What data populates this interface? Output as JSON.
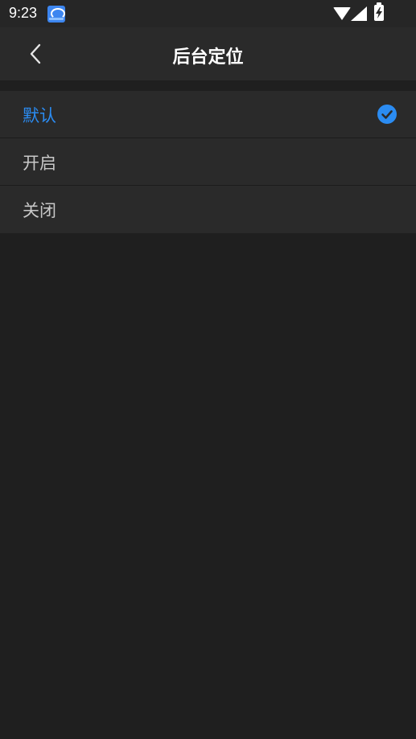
{
  "status_bar": {
    "time": "9:23",
    "notification_icon": "app-notification-icon",
    "wifi_icon": "wifi-icon",
    "signal_icon": "cellular-signal-icon",
    "battery_icon": "battery-charging-icon"
  },
  "header": {
    "title": "后台定位",
    "back_icon": "chevron-left-icon"
  },
  "options": [
    {
      "label": "默认",
      "selected": true
    },
    {
      "label": "开启",
      "selected": false
    },
    {
      "label": "关闭",
      "selected": false
    }
  ],
  "colors": {
    "accent": "#2b8cf2",
    "background": "#1f1f1f",
    "surface": "#2a2a2a",
    "text": "#c8c8c8"
  }
}
